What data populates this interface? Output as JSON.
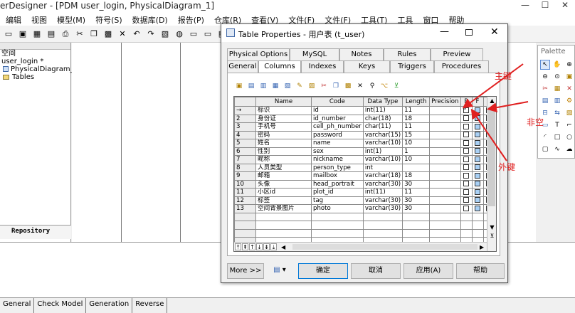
{
  "window": {
    "title": "erDesigner - [PDM user_login, PhysicalDiagram_1]",
    "min": "—",
    "max": "☐",
    "close": "✕"
  },
  "menu": [
    "编辑",
    "视图",
    "模型(M)",
    "符号(S)",
    "数据库(D)",
    "报告(P)",
    "仓库(R)",
    "查看(V)",
    "文件(F)",
    "文件(F)",
    "工具(T)",
    "工具",
    "窗口",
    "帮助"
  ],
  "toolbar_icons": [
    "open-folder-icon",
    "save-icon",
    "save-all-icon",
    "print-preview-icon",
    "print-icon",
    "cut-icon",
    "copy-icon",
    "paste-icon",
    "delete-icon",
    "undo-icon",
    "redo-icon",
    "properties-icon",
    "globe-icon",
    "folder-icon",
    "folder-icon",
    "table-icon"
  ],
  "tree": {
    "root": "空间",
    "model": "user_login *",
    "diagram": "PhysicalDiagram_1",
    "tables": "Tables"
  },
  "repository_tab": "Repository",
  "bottom_tabs": [
    "General",
    "Check Model",
    "Generation",
    "Reverse"
  ],
  "palette": {
    "title": "Palette"
  },
  "dialog": {
    "title": "Table Properties - 用户表 (t_user)",
    "tabs_row1": [
      "Physical Options",
      "MySQL",
      "Notes",
      "Rules",
      "Preview"
    ],
    "tabs_row2": [
      "General",
      "Columns",
      "Indexes",
      "Keys",
      "Triggers",
      "Procedures"
    ],
    "active_tab": "Columns",
    "columns_header": [
      "Name",
      "Code",
      "Data Type",
      "Length",
      "Precision",
      "P",
      "F",
      "M"
    ],
    "rows": [
      {
        "n": "→",
        "name": "标识",
        "code": "id",
        "type": "int(11)",
        "len": "11",
        "p": true,
        "f": false,
        "m": true
      },
      {
        "n": "2",
        "name": "身份证",
        "code": "id_number",
        "type": "char(18)",
        "len": "18",
        "p": false,
        "f": false,
        "m": false
      },
      {
        "n": "3",
        "name": "手机号",
        "code": "cell_ph_number",
        "type": "char(11)",
        "len": "11",
        "p": false,
        "f": false,
        "m": false
      },
      {
        "n": "4",
        "name": "密码",
        "code": "password",
        "type": "varchar(15)",
        "len": "15",
        "p": false,
        "f": false,
        "m": false
      },
      {
        "n": "5",
        "name": "姓名",
        "code": "name",
        "type": "varchar(10)",
        "len": "10",
        "p": false,
        "f": false,
        "m": false
      },
      {
        "n": "6",
        "name": "性别",
        "code": "sex",
        "type": "int(1)",
        "len": "1",
        "p": false,
        "f": false,
        "m": false
      },
      {
        "n": "7",
        "name": "昵称",
        "code": "nickname",
        "type": "varchar(10)",
        "len": "10",
        "p": false,
        "f": false,
        "m": false
      },
      {
        "n": "8",
        "name": "人员类型",
        "code": "person_type",
        "type": "int",
        "len": "",
        "p": false,
        "f": false,
        "m": false
      },
      {
        "n": "9",
        "name": "邮箱",
        "code": "mailbox",
        "type": "varchar(18)",
        "len": "18",
        "p": false,
        "f": false,
        "m": false
      },
      {
        "n": "10",
        "name": "头像",
        "code": "head_portrait",
        "type": "varchar(30)",
        "len": "30",
        "p": false,
        "f": false,
        "m": false
      },
      {
        "n": "11",
        "name": "小区id",
        "code": "plot_id",
        "type": "int(11)",
        "len": "11",
        "p": false,
        "f": false,
        "m": false
      },
      {
        "n": "12",
        "name": "标签",
        "code": "tag",
        "type": "varchar(30)",
        "len": "30",
        "p": false,
        "f": false,
        "m": false
      },
      {
        "n": "13",
        "name": "空间背景图片",
        "code": "photo",
        "type": "varchar(30)",
        "len": "30",
        "p": false,
        "f": false,
        "m": false
      }
    ],
    "empty_rows": 4,
    "buttons": {
      "more": "More >>",
      "ok": "确定",
      "cancel": "取消",
      "apply": "应用(A)",
      "help": "帮助"
    }
  },
  "annotations": {
    "primary_key": "主键",
    "not_null": "非空",
    "foreign_key": "外键",
    "color": "#e02020"
  }
}
